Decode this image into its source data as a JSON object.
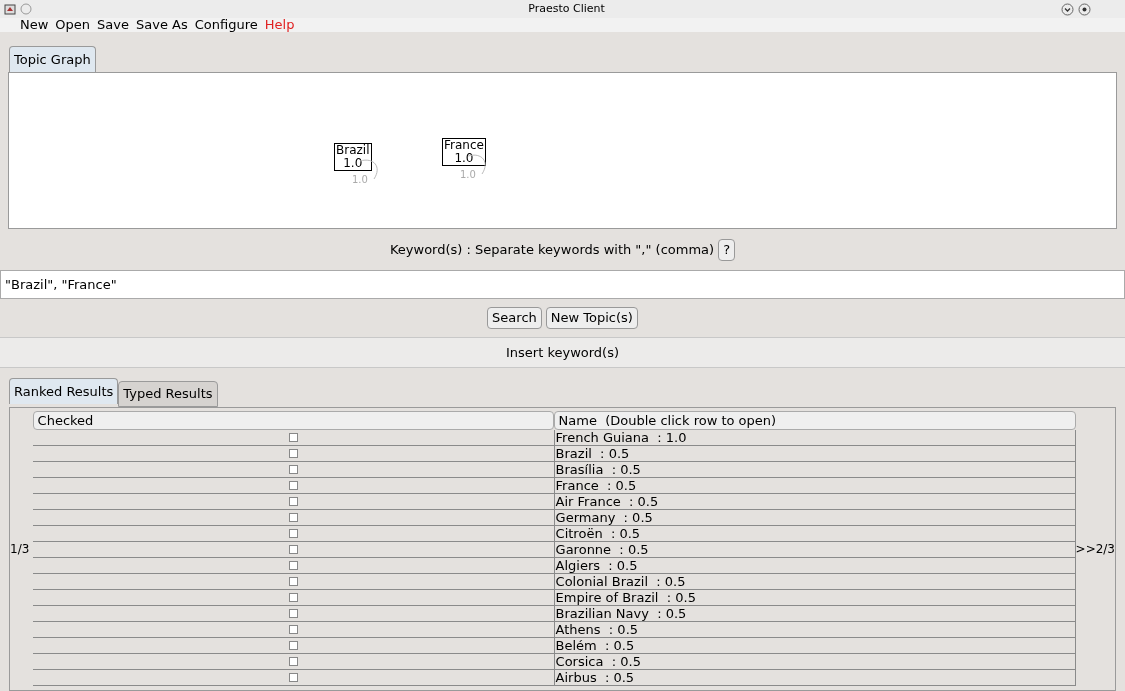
{
  "window": {
    "title": "Praesto Client"
  },
  "menu": [
    {
      "label": "New",
      "color": "#000000"
    },
    {
      "label": "Open",
      "color": "#000000"
    },
    {
      "label": "Save",
      "color": "#000000"
    },
    {
      "label": "Save As",
      "color": "#000000"
    },
    {
      "label": "Configure",
      "color": "#000000"
    },
    {
      "label": "Help",
      "color": "#e02020"
    }
  ],
  "graph_tabs": [
    {
      "label": "Topic Graph",
      "selected": true
    }
  ],
  "graph": {
    "nodes": [
      {
        "label": "Brazil",
        "weight": "1.0",
        "loop_label": "1.0"
      },
      {
        "label": "France",
        "weight": "1.0",
        "loop_label": "1.0"
      }
    ]
  },
  "keyword_label": "Keyword(s) : Separate keywords with \",\" (comma)",
  "help_button": "?",
  "keyword_field": {
    "value": "\"Brazil\", \"France\""
  },
  "buttons": [
    "Search",
    "New Topic(s)"
  ],
  "status": "Insert keyword(s)",
  "result_tabs": [
    {
      "label": "Ranked Results",
      "selected": true
    },
    {
      "label": "Typed Results",
      "selected": false
    }
  ],
  "table": {
    "columns": [
      "Checked",
      "Name  (Double click row to open)"
    ],
    "rows": [
      {
        "checked": false,
        "name": "French Guiana  : 1.0"
      },
      {
        "checked": false,
        "name": "Brazil  : 0.5"
      },
      {
        "checked": false,
        "name": "Brasília  : 0.5"
      },
      {
        "checked": false,
        "name": "France  : 0.5"
      },
      {
        "checked": false,
        "name": "Air France  : 0.5"
      },
      {
        "checked": false,
        "name": "Germany  : 0.5"
      },
      {
        "checked": false,
        "name": "Citroën  : 0.5"
      },
      {
        "checked": false,
        "name": "Garonne  : 0.5"
      },
      {
        "checked": false,
        "name": "Algiers  : 0.5"
      },
      {
        "checked": false,
        "name": "Colonial Brazil  : 0.5"
      },
      {
        "checked": false,
        "name": "Empire of Brazil  : 0.5"
      },
      {
        "checked": false,
        "name": "Brazilian Navy  : 0.5"
      },
      {
        "checked": false,
        "name": "Athens  : 0.5"
      },
      {
        "checked": false,
        "name": "Belém  : 0.5"
      },
      {
        "checked": false,
        "name": "Corsica  : 0.5"
      },
      {
        "checked": false,
        "name": "Airbus  : 0.5"
      }
    ]
  },
  "pager": {
    "current": "1/3",
    "next": ">>2/3"
  }
}
